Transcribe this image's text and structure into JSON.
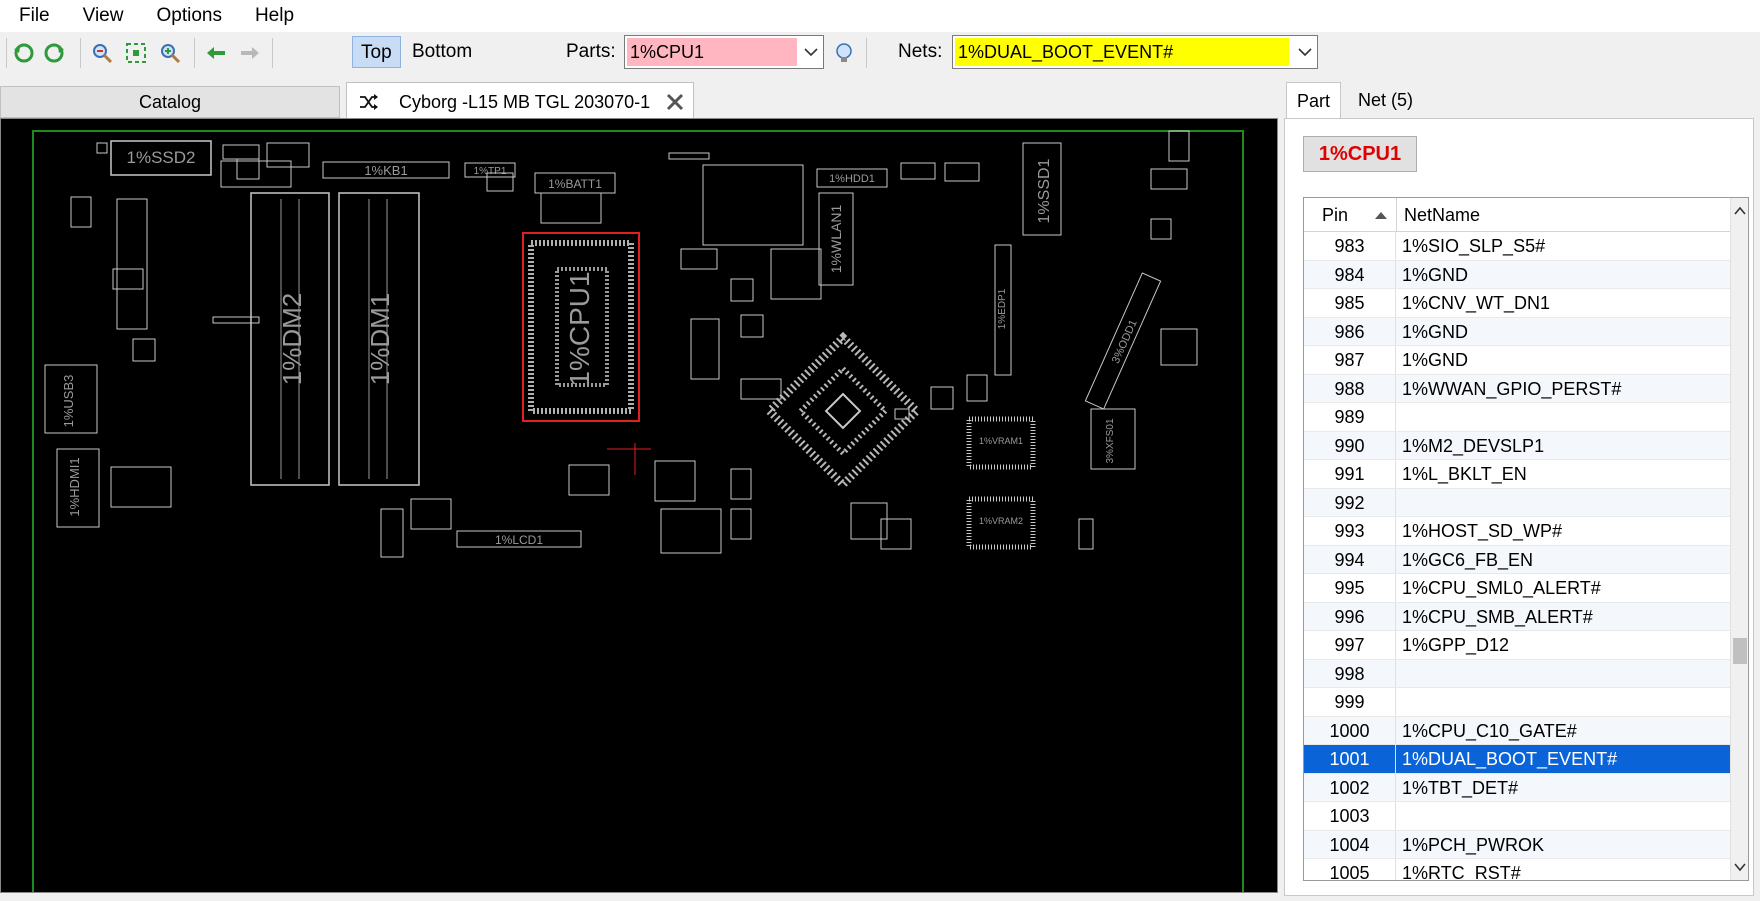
{
  "menu": [
    "File",
    "View",
    "Options",
    "Help"
  ],
  "toolbar": {
    "side_top": "Top",
    "side_bottom": "Bottom",
    "parts_label": "Parts:",
    "parts_value": "1%CPU1",
    "nets_label": "Nets:",
    "nets_value": "1%DUAL_BOOT_EVENT#",
    "colors": {
      "parts_bg": "#ffb6c1",
      "nets_bg": "#ffff00",
      "active_toggle": "#c9dcf5"
    }
  },
  "tabs": {
    "catalog": "Catalog",
    "board": "Cyborg -L15 MB TGL 203070-1"
  },
  "board": {
    "labels": {
      "ssd2": "1%SSD2",
      "kb1": "1%KB1",
      "tp1": "1%TP1",
      "batt1": "1%BATT1",
      "hdd1": "1%HDD1",
      "ssd1": "1%SSD1",
      "wlan1": "1%WLAN1",
      "dm2": "1%DM2",
      "dm1": "1%DM1",
      "cpu1": "1%CPU1",
      "usb3": "1%USB3",
      "hdmi1": "1%HDMI1",
      "lcd1": "1%LCD1",
      "vram1": "1%VRAM1",
      "vram2": "1%VRAM2",
      "odd1": "3%ODD1",
      "xfs01": "3%XFS01",
      "edp1": "1%EDP1"
    },
    "colors": {
      "background": "#000000",
      "outline": "#1f8a1f",
      "silkscreen": "#c8c8c8",
      "selected_part": "#e02020"
    }
  },
  "right_panel": {
    "tab_part": "Part",
    "tab_net": "Net (5)",
    "part_name": "1%CPU1",
    "col_pin": "Pin",
    "col_netname": "NetName",
    "rows": [
      {
        "pin": "983",
        "net": "1%SIO_SLP_S5#"
      },
      {
        "pin": "984",
        "net": "1%GND"
      },
      {
        "pin": "985",
        "net": "1%CNV_WT_DN1"
      },
      {
        "pin": "986",
        "net": "1%GND"
      },
      {
        "pin": "987",
        "net": "1%GND"
      },
      {
        "pin": "988",
        "net": "1%WWAN_GPIO_PERST#"
      },
      {
        "pin": "989",
        "net": ""
      },
      {
        "pin": "990",
        "net": "1%M2_DEVSLP1"
      },
      {
        "pin": "991",
        "net": "1%L_BKLT_EN"
      },
      {
        "pin": "992",
        "net": ""
      },
      {
        "pin": "993",
        "net": "1%HOST_SD_WP#"
      },
      {
        "pin": "994",
        "net": "1%GC6_FB_EN"
      },
      {
        "pin": "995",
        "net": "1%CPU_SML0_ALERT#"
      },
      {
        "pin": "996",
        "net": "1%CPU_SMB_ALERT#"
      },
      {
        "pin": "997",
        "net": "1%GPP_D12"
      },
      {
        "pin": "998",
        "net": ""
      },
      {
        "pin": "999",
        "net": ""
      },
      {
        "pin": "1000",
        "net": "1%CPU_C10_GATE#"
      },
      {
        "pin": "1001",
        "net": "1%DUAL_BOOT_EVENT#",
        "selected": true
      },
      {
        "pin": "1002",
        "net": "1%TBT_DET#"
      },
      {
        "pin": "1003",
        "net": ""
      },
      {
        "pin": "1004",
        "net": "1%PCH_PWROK"
      },
      {
        "pin": "1005",
        "net": "1%RTC_RST#"
      }
    ],
    "selection_color": "#0a64d8"
  }
}
